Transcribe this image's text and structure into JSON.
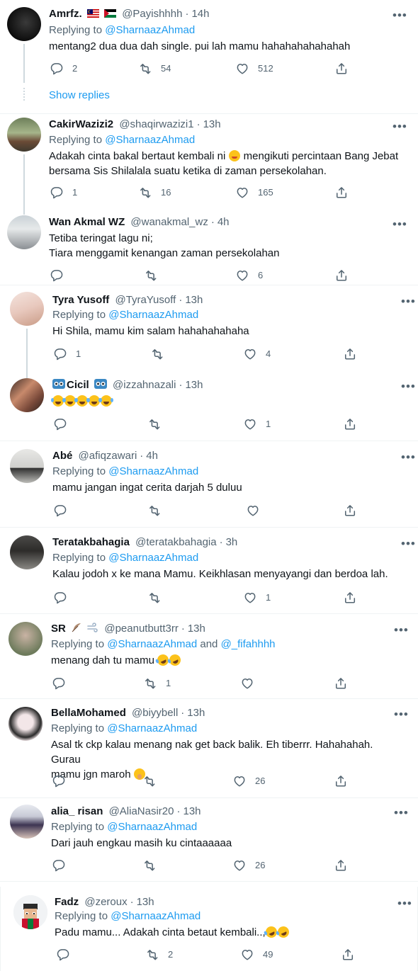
{
  "show_replies": "Show replies",
  "more_icon": "more-icon",
  "reply_prefix": "Replying to",
  "colors": {
    "link": "#1d9bf0",
    "muted": "#536471",
    "text": "#0f1419",
    "divider": "#eff3f4"
  },
  "tweets": [
    {
      "name": "Amrfz.",
      "handle": "@Payishhhh",
      "time": "14h",
      "replying": "@SharnaazAhmad",
      "text": "mentang2 dua dua dah single. pui lah mamu hahahahahahahah",
      "replies": "2",
      "retweets": "54",
      "likes": "512"
    },
    {
      "name": "CakirWazizi2",
      "handle": "@shaqirwazizi1",
      "time": "13h",
      "replying": "@SharnaazAhmad",
      "text1": "Adakah cinta bakal bertaut kembali ni",
      "text2": "mengikuti percintaan Bang Jebat",
      "text3": "bersama Sis Shilalala suatu ketika di zaman persekolahan.",
      "replies": "1",
      "retweets": "16",
      "likes": "165"
    },
    {
      "name": "Wan Akmal WZ",
      "handle": "@wanakmal_wz",
      "time": "4h",
      "text1": "Tetiba teringat lagu ni;",
      "text2": "Tiara menggamit kenangan zaman persekolahan",
      "replies": "",
      "retweets": "",
      "likes": "6"
    },
    {
      "name": "Tyra Yusoff",
      "handle": "@TyraYusoff",
      "time": "13h",
      "replying": "@SharnaazAhmad",
      "text": "Hi Shila, mamu kim salam hahahahahaha",
      "replies": "1",
      "retweets": "",
      "likes": "4"
    },
    {
      "name": "Cicil",
      "handle": "@izzahnazali",
      "time": "13h",
      "replies": "",
      "retweets": "",
      "likes": "1"
    },
    {
      "name": "Abé",
      "handle": "@afiqzawari",
      "time": "4h",
      "replying": "@SharnaazAhmad",
      "text": "mamu jangan ingat cerita darjah 5 duluu",
      "replies": "",
      "retweets": "",
      "likes": ""
    },
    {
      "name": "Teratakbahagia",
      "handle": "@teratakbahagia",
      "time": "3h",
      "replying": "@SharnaazAhmad",
      "text": "Kalau jodoh x ke mana Mamu. Keikhlasan menyayangi dan berdoa lah.",
      "replies": "",
      "retweets": "",
      "likes": "1"
    },
    {
      "name": "SR",
      "handle": "@peanutbutt3rr",
      "time": "13h",
      "replying": "@SharnaazAhmad",
      "replying_and": "and",
      "replying2": "@_fifahhhh",
      "text": "menang dah tu mamu",
      "replies": "",
      "retweets": "1",
      "likes": ""
    },
    {
      "name": "BellaMohamed",
      "handle": "@biyybell",
      "time": "13h",
      "replying": "@SharnaazAhmad",
      "text1": "Asal tk ckp kalau menang nak get back balik. Eh tiberrr. Hahahahah. Gurau",
      "text2": "mamu jgn maroh",
      "replies": "",
      "retweets": "",
      "likes": "26"
    },
    {
      "name": "alia_ risan",
      "handle": "@AliaNasir20",
      "time": "13h",
      "replying": "@SharnaazAhmad",
      "text": "Dari jauh engkau masih ku cintaaaaaa",
      "replies": "",
      "retweets": "",
      "likes": "26"
    },
    {
      "name": "Fadz",
      "handle": "@zeroux",
      "time": "13h",
      "replying": "@SharnaazAhmad",
      "text": "Padu mamu... Adakah cinta betaut kembali..,",
      "replies": "",
      "retweets": "2",
      "likes": "49"
    }
  ]
}
